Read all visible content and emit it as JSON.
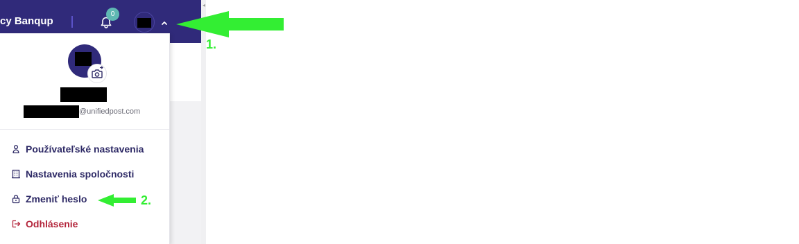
{
  "header": {
    "brand": "cy Banqup",
    "notification_count": "0"
  },
  "user_menu": {
    "email_domain": "@unifiedpost.com",
    "items": [
      {
        "label": "Používateľské nastavenia",
        "icon": "user-icon"
      },
      {
        "label": "Nastavenia spoločnosti",
        "icon": "building-icon"
      },
      {
        "label": "Zmeniť heslo",
        "icon": "lock-icon"
      },
      {
        "label": "Odhlásenie",
        "icon": "logout-icon"
      }
    ]
  },
  "annotations": {
    "step1": "1.",
    "step2": "2.",
    "arrow_color": "#33ee33"
  },
  "colors": {
    "header_bg": "#302a7a",
    "badge": "#5fb8b3",
    "menu_text": "#2e2a66",
    "logout_text": "#b3243a"
  }
}
